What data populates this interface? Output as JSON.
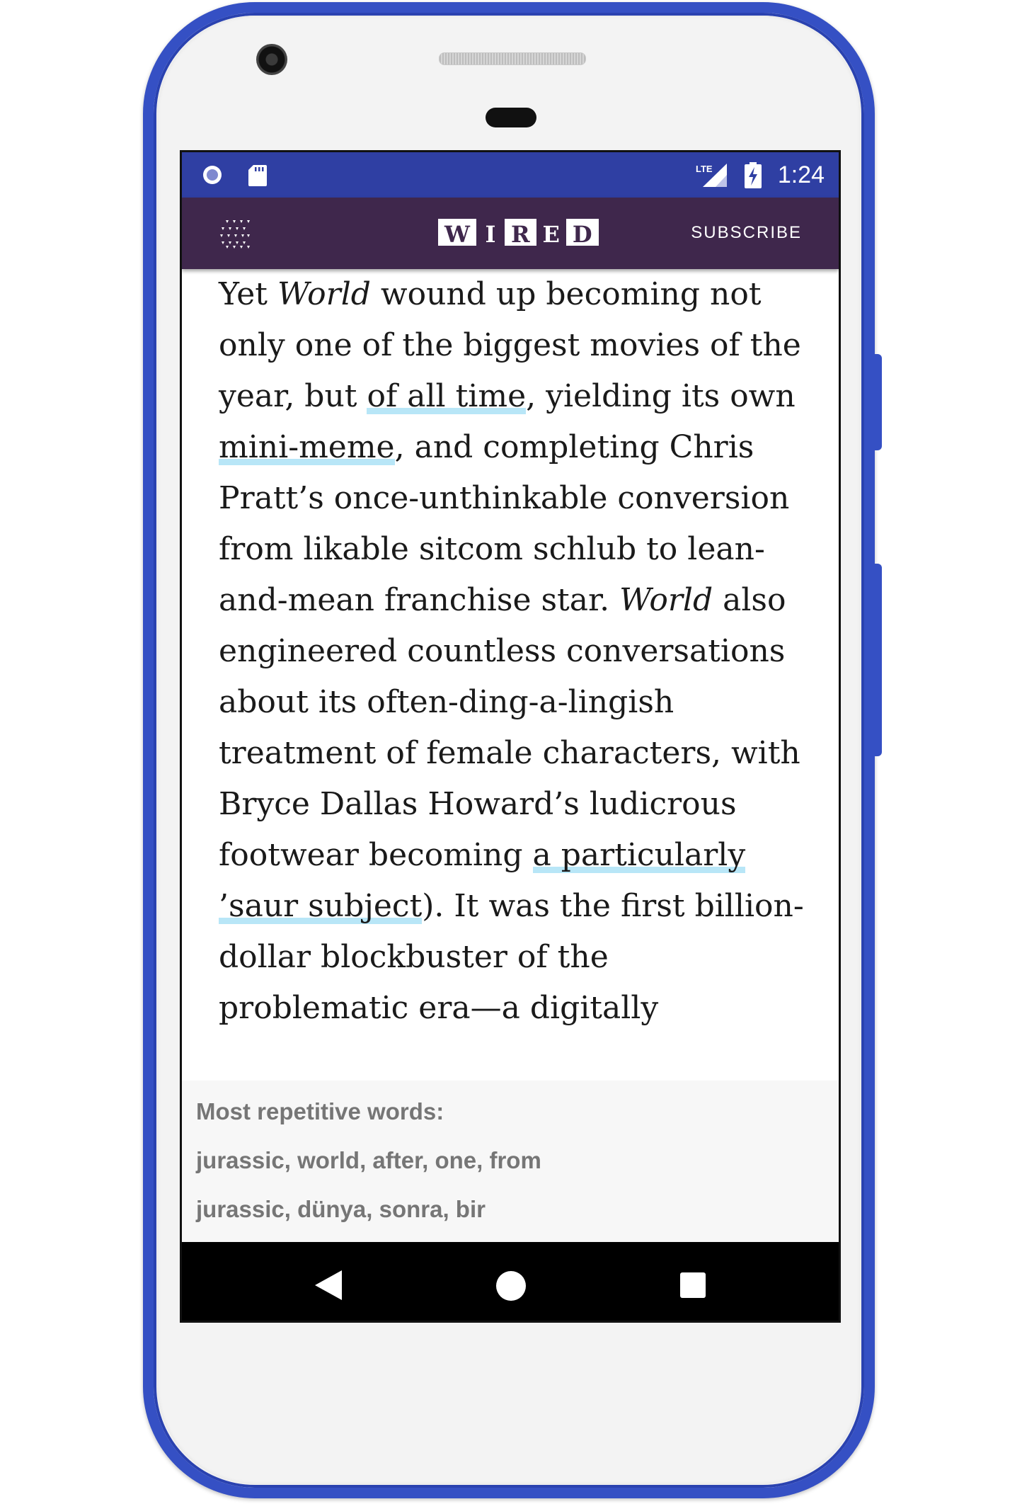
{
  "status_bar": {
    "time": "1:24",
    "network_label": "LTE",
    "icons": [
      "circle-notification-icon",
      "sd-card-icon",
      "lte-signal-icon",
      "battery-charging-icon"
    ]
  },
  "app_bar": {
    "logo_letters": [
      "W",
      "I",
      "R",
      "E",
      "D"
    ],
    "subscribe_label": "SUBSCRIBE",
    "menu_icon": "grid-menu-icon",
    "colors": {
      "app_bar": "#3f274c",
      "status_bar": "#2f3fa3",
      "link_highlight": "#b8e6f7"
    }
  },
  "article": {
    "segments": [
      {
        "text": "Yet ",
        "style": "normal"
      },
      {
        "text": "World",
        "style": "italic"
      },
      {
        "text": " wound up becoming not only one of the biggest movies of the year, but ",
        "style": "normal"
      },
      {
        "text": "of all time",
        "style": "link"
      },
      {
        "text": ", yielding its own ",
        "style": "normal"
      },
      {
        "text": "mini-meme",
        "style": "link"
      },
      {
        "text": ", and completing Chris Pratt’s once-unthinkable conversion from likable sitcom schlub to lean-and-mean franchise star. ",
        "style": "normal"
      },
      {
        "text": "World",
        "style": "italic"
      },
      {
        "text": " also engineered countless conversations about its often-ding-a-lingish treatment of female characters, with Bryce Dallas Howard’s ludicrous footwear becoming ",
        "style": "normal"
      },
      {
        "text": "a particularly ’saur subject",
        "style": "link"
      },
      {
        "text": "). It was the first billion-dollar blockbuster of the problematic era—a digitally",
        "style": "normal"
      }
    ]
  },
  "repetitive_words_panel": {
    "title": "Most repetitive words:",
    "english_words": "jurassic, world, after, one, from",
    "translated_words": "jurassic, dünya, sonra, bir"
  },
  "nav_bar": {
    "buttons": [
      "back-icon",
      "home-icon",
      "recent-apps-icon"
    ]
  }
}
